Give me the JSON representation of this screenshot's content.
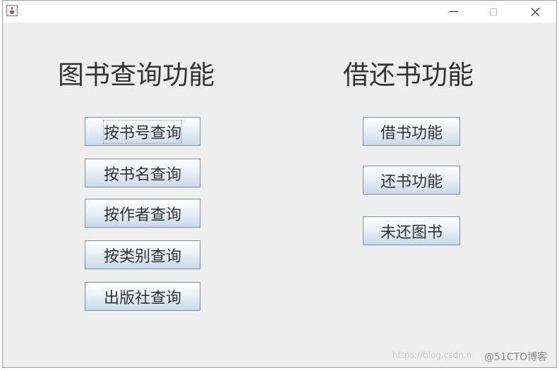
{
  "window": {
    "icon": "java-cup-icon"
  },
  "titlebar_controls": {
    "minimize_icon": "minimize-icon",
    "maximize_icon": "maximize-icon",
    "close_icon": "close-icon"
  },
  "left_panel": {
    "heading": "图书查询功能",
    "buttons": [
      {
        "label": "按书号查询"
      },
      {
        "label": "按书名查询"
      },
      {
        "label": "按作者查询"
      },
      {
        "label": "按类别查询"
      },
      {
        "label": "出版社查询"
      }
    ]
  },
  "right_panel": {
    "heading": "借还书功能",
    "buttons": [
      {
        "label": "借书功能"
      },
      {
        "label": "还书功能"
      },
      {
        "label": "未还图书"
      }
    ]
  },
  "watermark": {
    "url_text": "https://blog.csdn.n",
    "brand_text": "@51CTO博客"
  },
  "colors": {
    "window_bg": "#eeeeee",
    "titlebar_bg": "#ffffff",
    "button_border": "#7a8ea6",
    "text": "#333333"
  }
}
